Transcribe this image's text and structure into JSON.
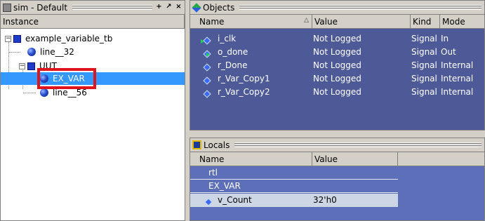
{
  "sim_pane": {
    "title": "sim - Default",
    "column_header": "Instance",
    "tree": [
      {
        "label": "example_variable_tb",
        "type": "module",
        "expanded": true
      },
      {
        "label": "line__32",
        "type": "process"
      },
      {
        "label": "UUT",
        "type": "module",
        "expanded": true
      },
      {
        "label": "EX_VAR",
        "type": "process",
        "selected": true
      },
      {
        "label": "line__56",
        "type": "process"
      }
    ]
  },
  "objects_pane": {
    "title": "Objects",
    "columns": [
      "Name",
      "Value",
      "Kind",
      "Mode"
    ],
    "rows": [
      {
        "name": "i_clk",
        "value": "Not Logged",
        "kind": "Signal",
        "mode": "In"
      },
      {
        "name": "o_done",
        "value": "Not Logged",
        "kind": "Signal",
        "mode": "Out"
      },
      {
        "name": "r_Done",
        "value": "Not Logged",
        "kind": "Signal",
        "mode": "Internal"
      },
      {
        "name": "r_Var_Copy1",
        "value": "Not Logged",
        "kind": "Signal",
        "mode": "Internal"
      },
      {
        "name": "r_Var_Copy2",
        "value": "Not Logged",
        "kind": "Signal",
        "mode": "Internal"
      }
    ]
  },
  "locals_pane": {
    "title": "Locals",
    "columns": [
      "Name",
      "Value"
    ],
    "groups": [
      "rtl",
      "EX_VAR"
    ],
    "rows": [
      {
        "name": "v_Count",
        "value": "32'h0"
      }
    ]
  },
  "window_buttons": {
    "add": "+",
    "undock": "↗",
    "close": "×"
  },
  "colors": {
    "objects_bg": "#4e5a98",
    "locals_bg": "#5d6fb8",
    "selection": "#3399ff",
    "highlight_box": "#e0141c"
  }
}
